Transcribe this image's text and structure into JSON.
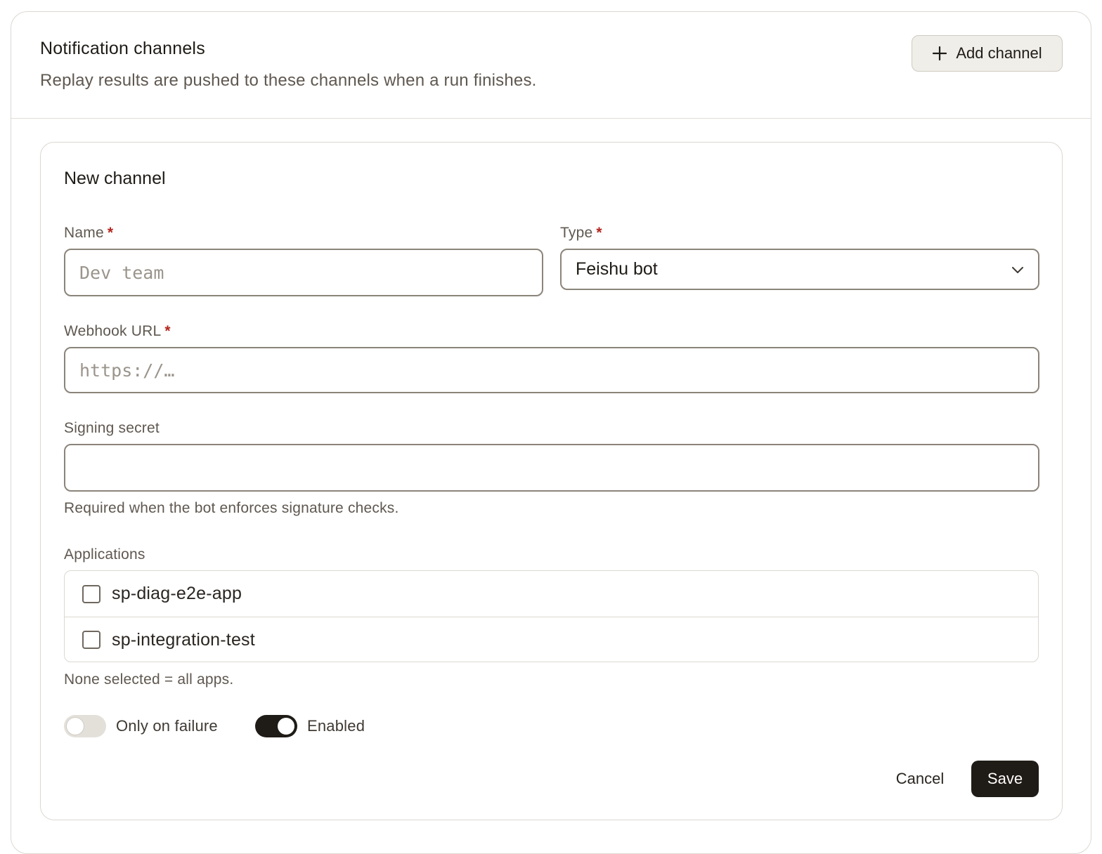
{
  "header": {
    "title": "Notification channels",
    "subtitle": "Replay results are pushed to these channels when a run finishes.",
    "add_button_label": "Add channel"
  },
  "form": {
    "title": "New channel",
    "required_marker": "*",
    "name": {
      "label": "Name",
      "value": "",
      "placeholder": "Dev team"
    },
    "type": {
      "label": "Type",
      "selected": "Feishu bot"
    },
    "webhook": {
      "label": "Webhook URL",
      "value": "",
      "placeholder": "https://…"
    },
    "secret": {
      "label": "Signing secret",
      "value": "",
      "hint": "Required when the bot enforces signature checks."
    },
    "applications": {
      "label": "Applications",
      "items": [
        {
          "label": "sp-diag-e2e-app",
          "checked": false
        },
        {
          "label": "sp-integration-test",
          "checked": false
        }
      ],
      "hint": "None selected = all apps."
    },
    "toggles": {
      "only_on_failure": {
        "label": "Only on failure",
        "on": false
      },
      "enabled": {
        "label": "Enabled",
        "on": true
      }
    },
    "cancel_label": "Cancel",
    "save_label": "Save"
  },
  "icons": {
    "add": "plus-icon",
    "select": "chevron-down-icon"
  }
}
